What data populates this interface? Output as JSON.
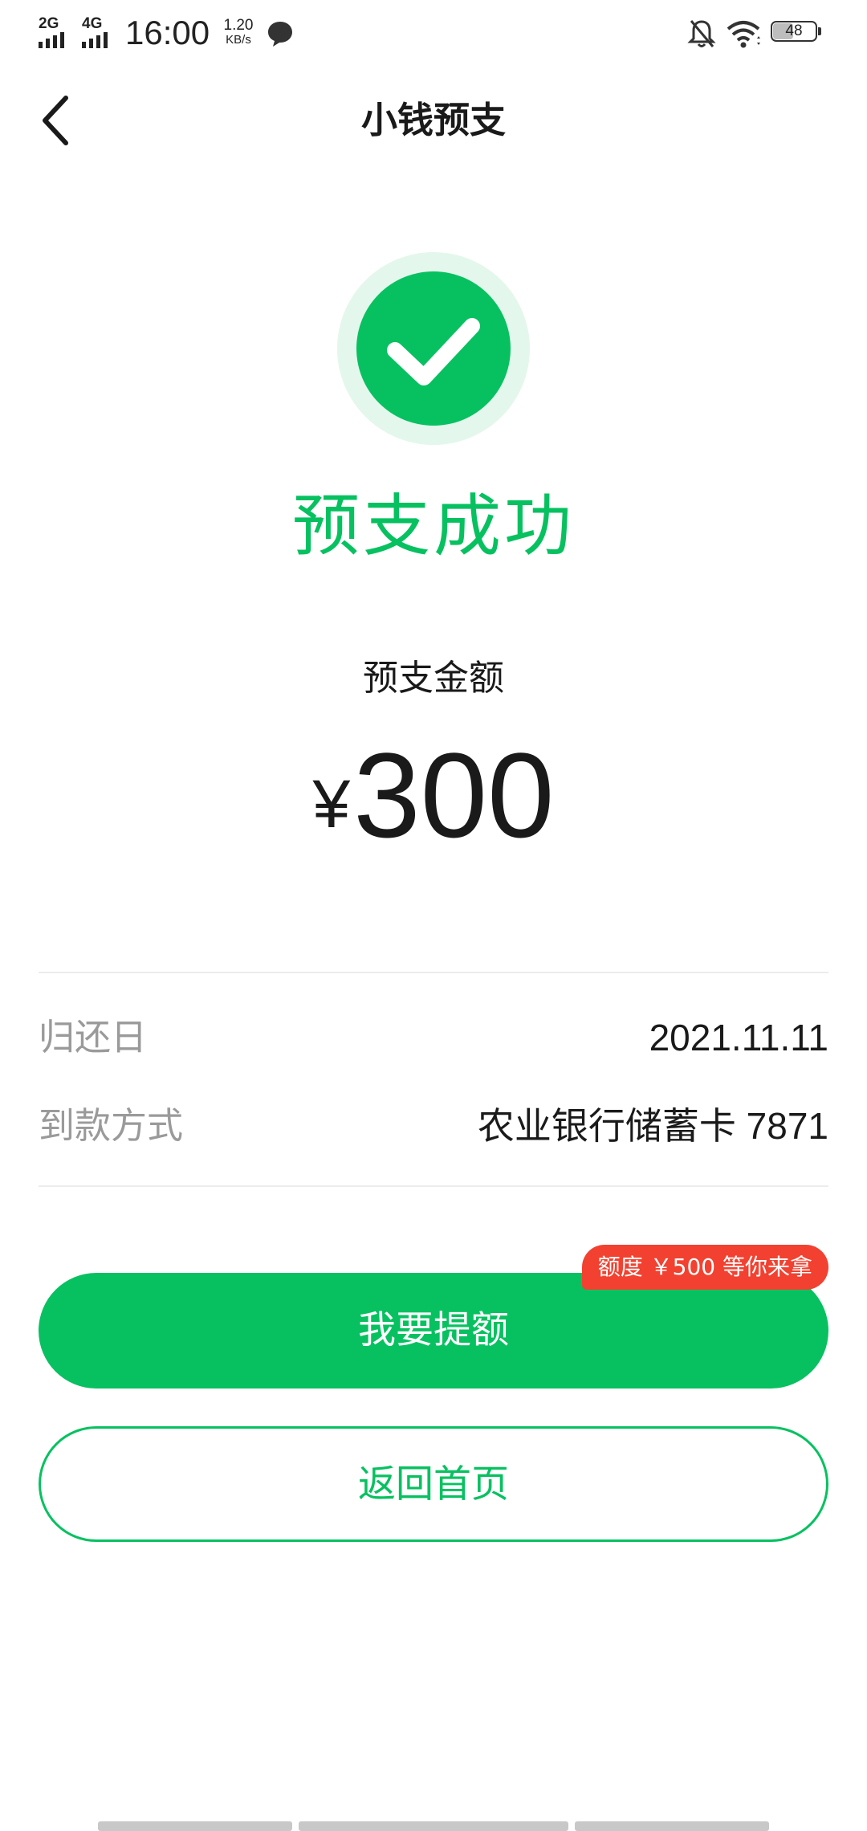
{
  "status_bar": {
    "signal1_label": "2G",
    "signal2_label": "4G",
    "time": "16:00",
    "net_speed_value": "1.20",
    "net_speed_unit": "KB/s",
    "battery_level": "48"
  },
  "nav": {
    "title": "小钱预支"
  },
  "result": {
    "status": "预支成功",
    "amount_label": "预支金额",
    "currency": "¥",
    "amount": "300"
  },
  "details": {
    "rows": [
      {
        "label": "归还日",
        "value": "2021.11.11"
      },
      {
        "label": "到款方式",
        "value": "农业银行储蓄卡 7871"
      }
    ]
  },
  "actions": {
    "promo_badge": "额度 ￥500 等你来拿",
    "primary_label": "我要提额",
    "secondary_label": "返回首页"
  },
  "colors": {
    "brand_green": "#07c160",
    "light_green": "#e4f7ec",
    "badge_red": "#f24130"
  },
  "icons": {
    "back": "chevron-left-icon",
    "success": "check-circle-icon",
    "message": "chat-bubble-icon",
    "bell": "bell-off-icon",
    "wifi": "wifi-icon"
  }
}
